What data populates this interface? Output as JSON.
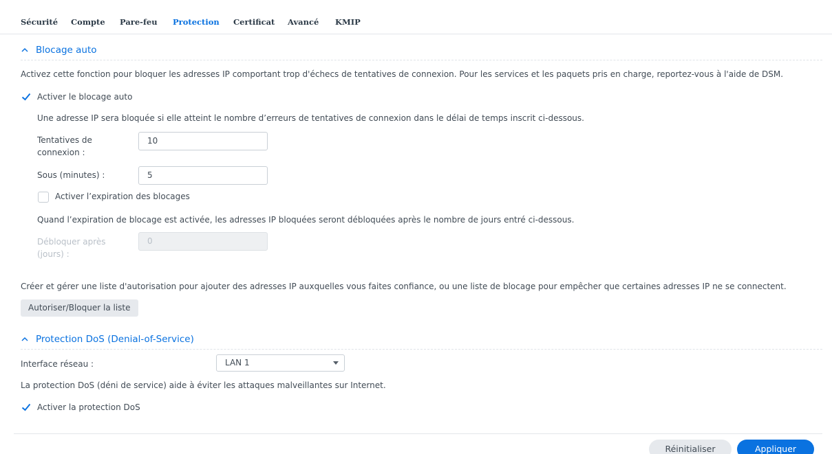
{
  "tabs": [
    {
      "label": "Sécurité"
    },
    {
      "label": "Compte"
    },
    {
      "label": "Pare-feu"
    },
    {
      "label": "Protection",
      "active": true
    },
    {
      "label": "Certificat"
    },
    {
      "label": "Avancé"
    },
    {
      "label": "KMIP"
    }
  ],
  "auto_block": {
    "title": "Blocage auto",
    "description": "Activez cette fonction pour bloquer les adresses IP comportant trop d'échecs de tentatives de connexion. Pour les services et les paquets pris en charge, reportez-vous à l'aide de DSM.",
    "enable_label": "Activer le blocage auto",
    "enable_checked": true,
    "rule_text": "Une adresse IP sera bloquée si elle atteint le nombre d’erreurs de tentatives de connexion dans le délai de temps inscrit ci-dessous.",
    "attempts_label": "Tentatives de connexion :",
    "attempts_value": "10",
    "within_label": "Sous (minutes) :",
    "within_value": "5",
    "expiration_label": "Activer l’expiration des blocages",
    "expiration_checked": false,
    "expiration_text": "Quand l’expiration de blocage est activée, les adresses IP bloquées seront débloquées après le nombre de jours entré ci-dessous.",
    "unblock_label": "Débloquer après (jours) :",
    "unblock_value": "0",
    "list_text": "Créer et gérer une liste d'autorisation pour ajouter des adresses IP auxquelles vous faites confiance, ou une liste de blocage pour empêcher que certaines adresses IP ne se connectent.",
    "list_button": "Autoriser/Bloquer la liste"
  },
  "dos": {
    "title": "Protection DoS (Denial-of-Service)",
    "interface_label": "Interface réseau :",
    "interface_value": "LAN 1",
    "description": "La protection DoS (déni de service) aide à éviter les attaques malveillantes sur Internet.",
    "enable_label": "Activer la protection DoS",
    "enable_checked": true
  },
  "footer": {
    "reset_label": "Réinitialiser",
    "apply_label": "Appliquer"
  },
  "colors": {
    "accent": "#0a72e0",
    "text": "#414b55",
    "disabled_text": "#b9c0c8"
  },
  "icons": {
    "section_toggle": "chevron-up-icon",
    "checkbox": "checkmark-icon",
    "select": "caret-down-icon"
  }
}
